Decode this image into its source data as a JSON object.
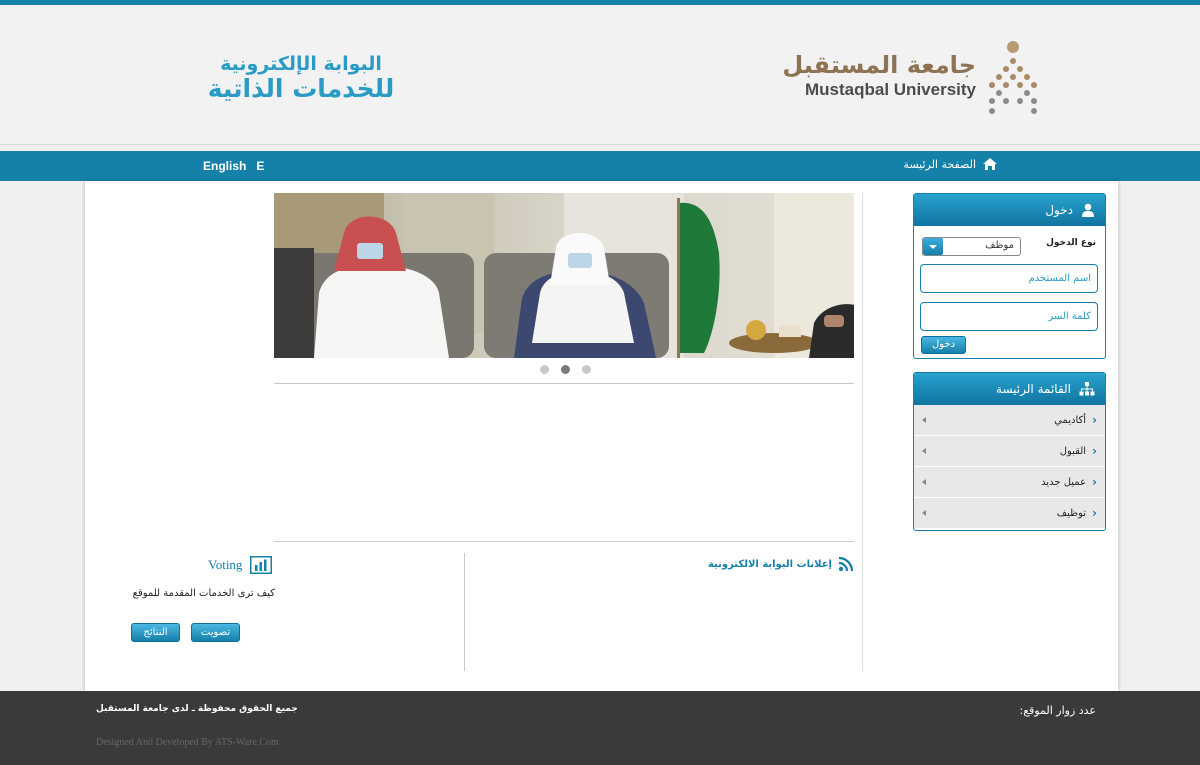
{
  "header": {
    "portal_logo_line1": "البوابة الإلكترونية",
    "portal_logo_line2": "للخدمات الذاتية",
    "university_name_ar": "جامعة المستقبل",
    "university_name_en": "Mustaqbal University"
  },
  "nav": {
    "home": "الصفحة الرئيسة",
    "language": "English",
    "language_icon": "E"
  },
  "login": {
    "title": "دخول",
    "login_type_label": "نوع الدخول",
    "login_type_value": "موظف",
    "username_placeholder": "اسم المستخدم",
    "password_placeholder": "كلمة السر",
    "submit": "دخول"
  },
  "main_menu": {
    "title": "القائمة الرئيسة",
    "items": [
      {
        "label": "أكاديمي"
      },
      {
        "label": "القبول"
      },
      {
        "label": "عميل جديد"
      },
      {
        "label": "توظيف"
      }
    ]
  },
  "slider": {
    "slides": 3,
    "active_slide": 2
  },
  "announcements": {
    "title": "إعلانات البوابة الالكترونية"
  },
  "voting": {
    "title": "Voting",
    "question": "كيف ترى الخدمات المقدمة للموقع",
    "vote_button": "تصويت",
    "results_button": "النتائج"
  },
  "footer": {
    "copyright": "جميع الحقوق محفوظة ـ لدى جامعة المستقبل",
    "visitors": "عدد زوار الموقع:",
    "designed_by": "Designed And Developed By ATS-Ware.Com"
  },
  "colors": {
    "primary": "#1580a8",
    "accent_gold": "#8e7254",
    "footer_bg": "#3a3a3a"
  }
}
